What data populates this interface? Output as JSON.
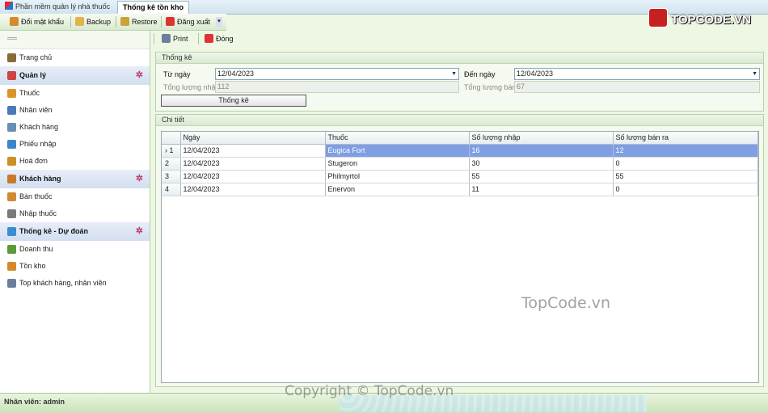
{
  "tabs": [
    {
      "label": "Phần mềm quản lý nhà thuốc",
      "active": false
    },
    {
      "label": "Thống kê tồn kho",
      "active": true
    }
  ],
  "top_toolbar": {
    "change_password": "Đổi mật khẩu",
    "backup": "Backup",
    "restore": "Restore",
    "logout": "Đăng xuất"
  },
  "logo": {
    "text": "TOPCODE.VN"
  },
  "sidebar": {
    "items": [
      {
        "label": "Trang chủ",
        "type": "item",
        "icon": "home-icon"
      },
      {
        "label": "Quản lý",
        "type": "group",
        "icon": "manage-icon"
      },
      {
        "label": "Thuốc",
        "type": "item",
        "icon": "medicine-icon"
      },
      {
        "label": "Nhân viên",
        "type": "item",
        "icon": "staff-icon"
      },
      {
        "label": "Khách hàng",
        "type": "item",
        "icon": "customer-icon"
      },
      {
        "label": "Phiếu nhập",
        "type": "item",
        "icon": "import-slip-icon"
      },
      {
        "label": "Hoá đơn",
        "type": "item",
        "icon": "invoice-icon"
      },
      {
        "label": "Khách hàng",
        "type": "group",
        "icon": "user-icon"
      },
      {
        "label": "Bán thuốc",
        "type": "item",
        "icon": "sell-icon"
      },
      {
        "label": "Nhập thuốc",
        "type": "item",
        "icon": "import-icon"
      },
      {
        "label": "Thống kê - Dự đoán",
        "type": "group",
        "icon": "stats-icon"
      },
      {
        "label": "Doanh thu",
        "type": "item",
        "icon": "revenue-icon"
      },
      {
        "label": "Tồn kho",
        "type": "item",
        "icon": "stock-icon"
      },
      {
        "label": "Top khách hàng, nhân viên",
        "type": "item",
        "icon": "top-list-icon"
      }
    ]
  },
  "main_toolbar": {
    "print": "Print",
    "close": "Đóng"
  },
  "stats": {
    "title": "Thống kê",
    "from_label": "Từ ngày",
    "from_value": "12/04/2023",
    "to_label": "Đến ngày",
    "to_value": "12/04/2023",
    "total_import_label": "Tổng lượng nhập",
    "total_import_value": "112",
    "total_sold_label": "Tổng lượng bán",
    "total_sold_value": "67",
    "button": "Thống kê"
  },
  "detail": {
    "title": "Chi tiết",
    "columns": [
      "Ngày",
      "Thuốc",
      "Số lượng nhập",
      "Số lượng bán ra"
    ],
    "rows": [
      {
        "header": "1",
        "cells": [
          "12/04/2023",
          "Eugica Fort",
          "16",
          "12"
        ],
        "selected": true
      },
      {
        "header": "2",
        "cells": [
          "12/04/2023",
          "Stugeron",
          "30",
          "0"
        ],
        "selected": false
      },
      {
        "header": "3",
        "cells": [
          "12/04/2023",
          "Philmyrtol",
          "55",
          "55"
        ],
        "selected": false
      },
      {
        "header": "4",
        "cells": [
          "12/04/2023",
          "Enervon",
          "11",
          "0"
        ],
        "selected": false
      }
    ]
  },
  "status": {
    "user": "Nhân viên: admin"
  },
  "watermarks": [
    "TopCode.vn",
    "Copyright © TopCode.vn"
  ],
  "colors": {
    "selection": "#7f9ee3",
    "app_bg": "#eef7e4",
    "group_toggle": "#c03b6a"
  }
}
